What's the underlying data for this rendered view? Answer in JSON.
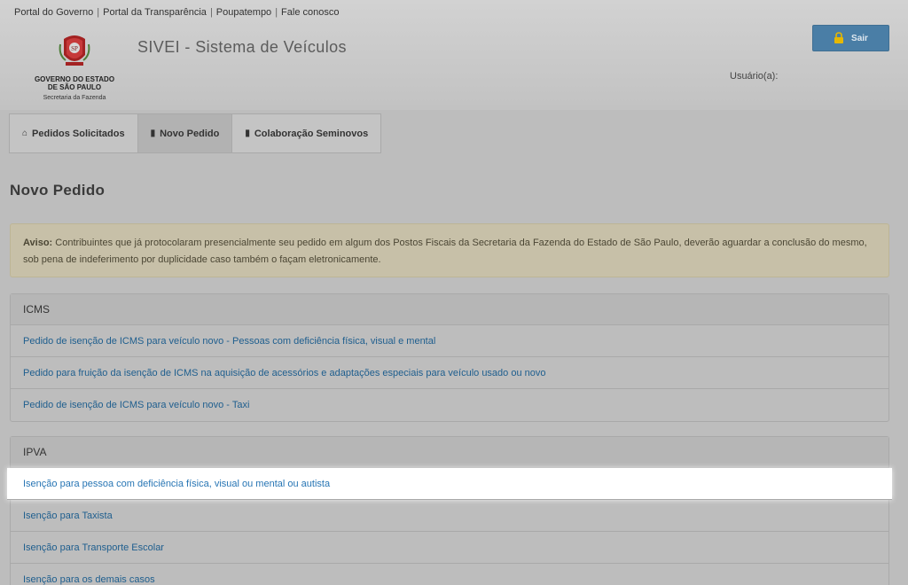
{
  "top_links": [
    "Portal do Governo",
    "Portal da Transparência",
    "Poupatempo",
    "Fale conosco"
  ],
  "logo": {
    "line1": "GOVERNO DO ESTADO",
    "line2": "DE SÃO PAULO",
    "line3": "Secretaria da Fazenda",
    "emblem_icon": "sp-coat-of-arms-icon"
  },
  "app_title": "SIVEI - Sistema de Veículos",
  "logout": {
    "label": "Sair",
    "icon": "lock-icon",
    "color": "#4a7ea6"
  },
  "user_label": "Usuário(a):",
  "tabs": [
    {
      "label": "Pedidos Solicitados",
      "icon": "home-icon",
      "active": false
    },
    {
      "label": "Novo Pedido",
      "icon": "document-icon",
      "active": true
    },
    {
      "label": "Colaboração Seminovos",
      "icon": "document-icon",
      "active": false
    }
  ],
  "page_title": "Novo Pedido",
  "alert": {
    "prefix": "Aviso:",
    "text": "Contribuintes que já protocolaram presencialmente seu pedido em algum dos Postos Fiscais da Secretaria da Fazenda do Estado de São Paulo, deverão aguardar a conclusão do mesmo, sob pena de indeferimento por duplicidade caso também o façam eletronicamente."
  },
  "panels": [
    {
      "heading": "ICMS",
      "items": [
        "Pedido de isenção de ICMS para veículo novo - Pessoas com deficiência física, visual e mental",
        "Pedido para fruição da isenção de ICMS na aquisição de acessórios e adaptações especiais para veículo usado ou novo",
        "Pedido de isenção de ICMS para veículo novo - Taxi"
      ]
    },
    {
      "heading": "IPVA",
      "items": [
        "Isenção para pessoa com deficiência física, visual ou mental ou autista",
        "Isenção para Taxista",
        "Isenção para Transporte Escolar",
        "Isenção para os demais casos"
      ]
    }
  ],
  "colors": {
    "link": "#1e5e8e",
    "highlight_bg": "#ffffff",
    "alert_bg": "#c7c0a8"
  }
}
